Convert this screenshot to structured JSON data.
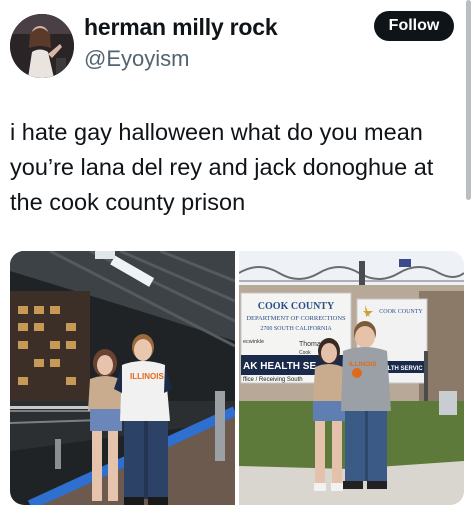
{
  "author": {
    "display_name": "herman milly rock",
    "handle": "@Eyoyism",
    "avatar_icon": "profile-photo-avatar"
  },
  "follow_button": {
    "label": "Follow"
  },
  "tweet": {
    "text": "i hate gay halloween what do you mean you’re lana del rey and jack donoghue at the cook county prison"
  },
  "media": {
    "photo1": {
      "shirt_text": "ILLINOIS"
    },
    "photo2": {
      "sign_title": "COOK COUNTY",
      "sign_subtitle": "DEPARTMENT OF CORRECTIONS",
      "sign_address": "2700 SOUTH CALIFORNIA",
      "sign_lower_1": "ecwinkle",
      "sign_lower_2": "Thomas",
      "sign_lower_3": "Cook",
      "sign_banner": "AK HEALTH SE",
      "sign_banner_sub": "ffice / Receiving South",
      "right_sign_title": "COOK COUNTY",
      "right_sign_banner": "ALTH SERVIC",
      "shirt_text": "ILLINOIS"
    }
  },
  "colors": {
    "text": "#0f1419",
    "secondary": "#536471",
    "follow_bg": "#0f1419",
    "sign_blue": "#2a4f8a"
  }
}
